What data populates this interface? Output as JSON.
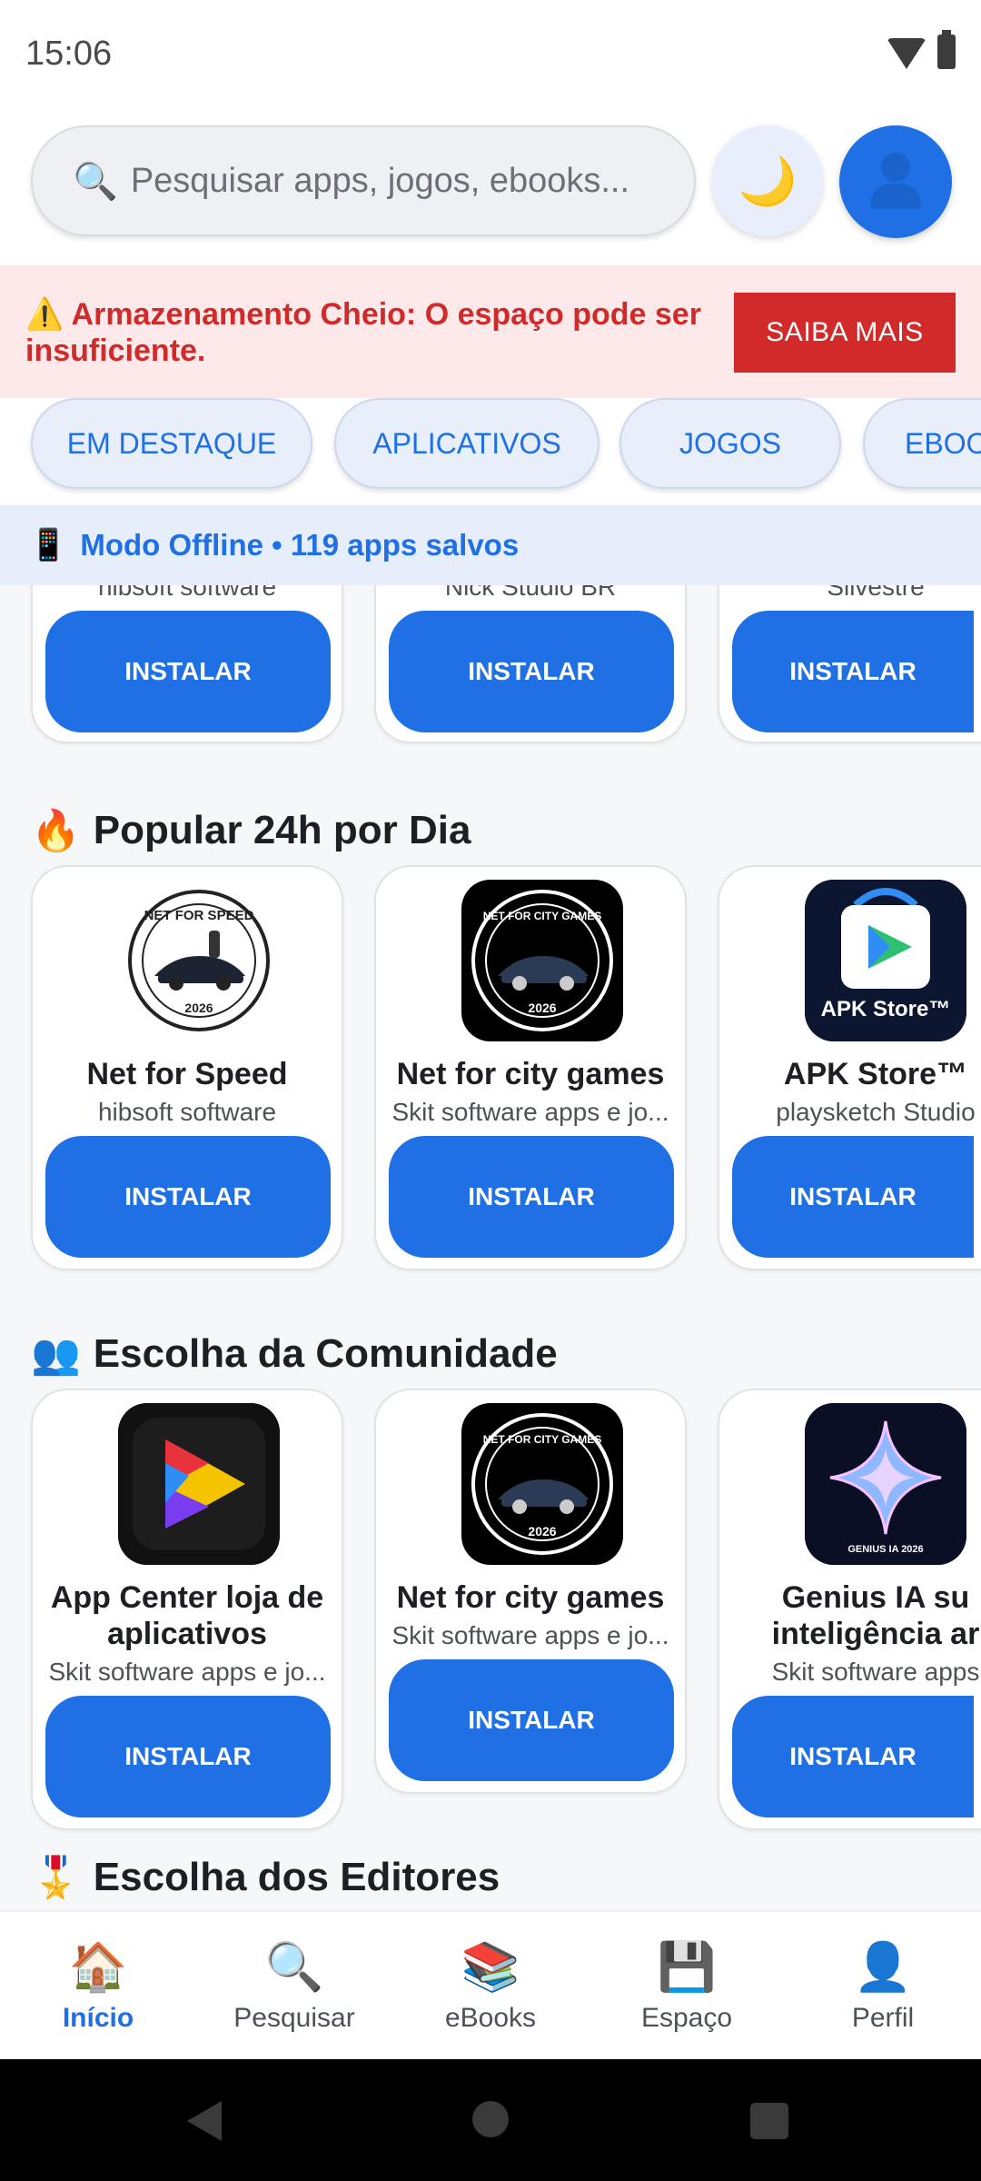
{
  "status_bar": {
    "time": "15:06"
  },
  "header": {
    "search_placeholder": "Pesquisar apps, jogos, ebooks...",
    "search_icon": "search-icon",
    "theme_icon": "moon-icon",
    "profile_icon": "user-icon"
  },
  "warning": {
    "icon": "⚠️",
    "message": "Armazenamento Cheio: O espaço pode ser insuficiente.",
    "button": "SAIBA MAIS"
  },
  "tabs": [
    "EM DESTAQUE",
    "APLICATIVOS",
    "JOGOS",
    "EBOOKS"
  ],
  "offline": {
    "icon": "📱",
    "text": "Modo Offline • 119 apps salvos"
  },
  "top_row": {
    "devs": [
      "hibsoft software",
      "Nick Studio BR",
      "Silvestre"
    ],
    "install_label": "INSTALAR"
  },
  "sections": [
    {
      "emoji": "🔥",
      "title": "Popular 24h por Dia",
      "apps": [
        {
          "name": "Net for Speed",
          "dev": "hibsoft software",
          "install": "INSTALAR",
          "icon": "net-for-speed-logo",
          "badge": "NET FOR SPEED",
          "year": "2026"
        },
        {
          "name": "Net for city games",
          "dev": "Skit software apps e jo...",
          "install": "INSTALAR",
          "icon": "net-for-city-games-logo",
          "badge": "NET FOR CITY GAMES",
          "year": "2026"
        },
        {
          "name": "APK Store™",
          "dev": "playsketch Studio",
          "install": "INSTALAR",
          "icon": "apk-store-logo",
          "badge": "APK Store™"
        }
      ]
    },
    {
      "emoji": "👥",
      "title": "Escolha da Comunidade",
      "apps": [
        {
          "name_line1": "App Center loja de",
          "name_line2": "aplicativos",
          "dev": "Skit software apps e jo...",
          "install": "INSTALAR",
          "icon": "app-center-logo"
        },
        {
          "name": "Net for city games",
          "dev": "Skit software apps e jo...",
          "install": "INSTALAR",
          "icon": "net-for-city-games-logo",
          "badge": "NET FOR CITY GAMES",
          "year": "2026"
        },
        {
          "name_line1": "Genius IA su",
          "name_line2": "inteligência ar",
          "dev": "Skit software apps",
          "install": "INSTALAR",
          "icon": "genius-ia-logo",
          "badge": "GENIUS IA 2026"
        }
      ]
    },
    {
      "emoji": "🎖️",
      "title": "Escolha dos Editores"
    }
  ],
  "bottom_nav": [
    {
      "label": "Início",
      "icon": "🏠",
      "active": true
    },
    {
      "label": "Pesquisar",
      "icon": "🔍",
      "active": false
    },
    {
      "label": "eBooks",
      "icon": "📚",
      "active": false
    },
    {
      "label": "Espaço",
      "icon": "💾",
      "active": false
    },
    {
      "label": "Perfil",
      "icon": "👤",
      "active": false
    }
  ],
  "colors": {
    "accent": "#1f6fe5",
    "warning": "#d22a2a",
    "warning_bg": "#fde9ea"
  }
}
